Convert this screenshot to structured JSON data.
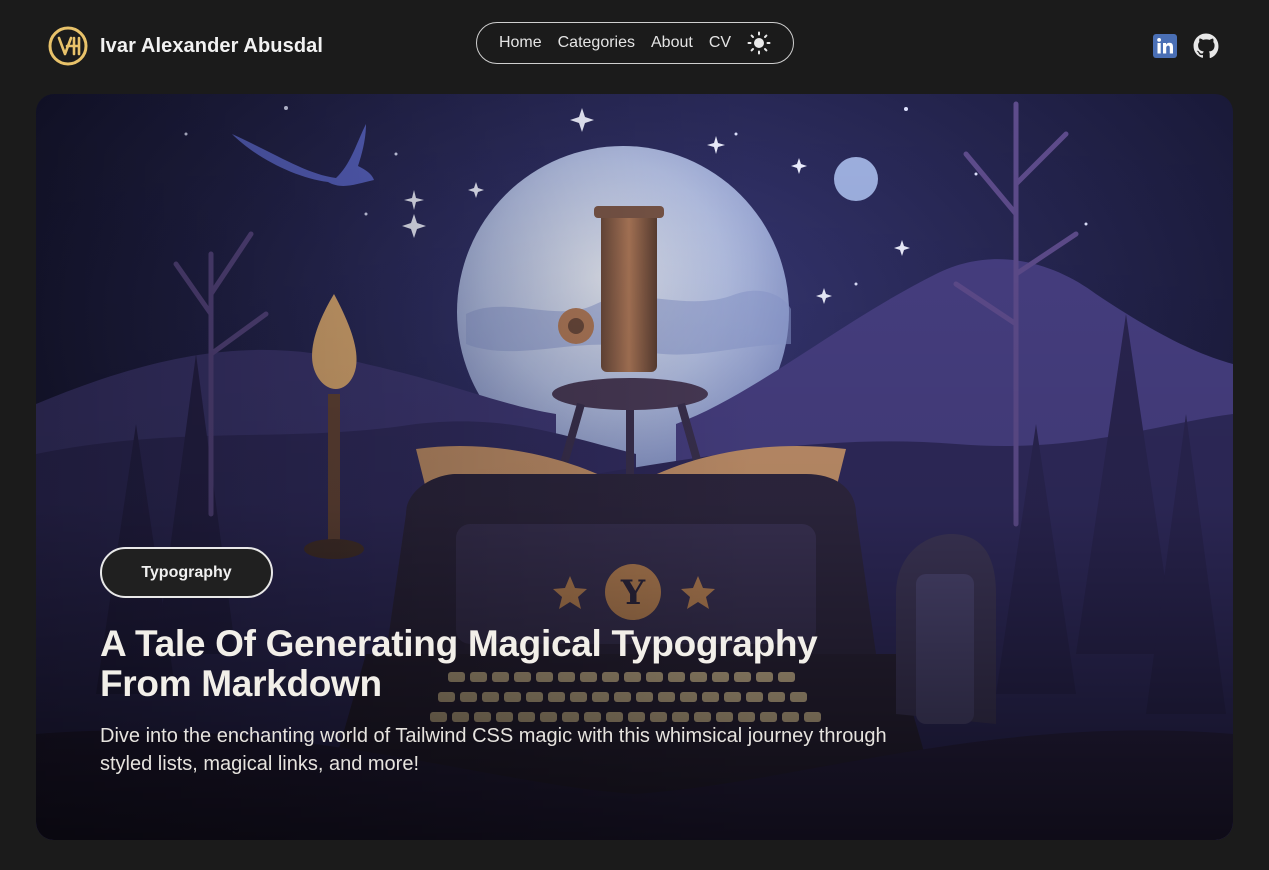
{
  "header": {
    "site_name": "Ivar Alexander Abusdal",
    "logo_icon": "monogram-logo-icon",
    "nav": [
      {
        "label": "Home"
      },
      {
        "label": "Categories"
      },
      {
        "label": "About"
      },
      {
        "label": "CV"
      }
    ],
    "theme_toggle_icon": "sun-icon",
    "social": [
      {
        "icon": "linkedin-icon"
      },
      {
        "icon": "github-icon"
      }
    ]
  },
  "hero": {
    "category": "Typography",
    "title": "A Tale Of Generating Magical Typography From Markdown",
    "subtitle": "Dive into the enchanting world of Tailwind CSS magic with this whimsical journey through styled lists, magical links, and more!",
    "typewriter_letter": "Y"
  },
  "colors": {
    "background": "#1b1b1b",
    "logo_gold": "#e8c26a",
    "linkedin_blue": "#4a6fb5"
  }
}
